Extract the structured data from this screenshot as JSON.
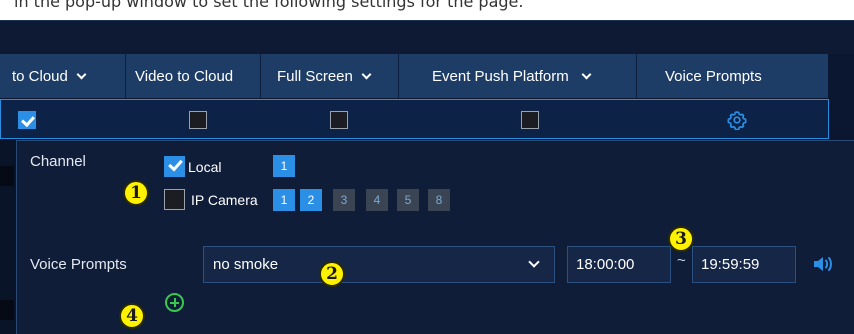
{
  "doc_caption": "in the pop-up window to set the following settings for the page.",
  "columns": {
    "upload_to_cloud": "to Cloud",
    "video_to_cloud": "Video to Cloud",
    "full_screen": "Full Screen",
    "event_push_platform": "Event Push Platform",
    "voice_prompts": "Voice Prompts"
  },
  "row_checks": {
    "upload_to_cloud": true,
    "video_to_cloud": false,
    "full_screen": false,
    "event_push_platform": false
  },
  "icons": {
    "settings": "gear-icon",
    "speaker": "speaker-icon",
    "add": "plus-circle-icon"
  },
  "panel": {
    "channel_label": "Channel",
    "local_label": "Local",
    "local_checked": true,
    "ip_camera_label": "IP Camera",
    "ip_camera_checked": false,
    "local_channels": [
      "1"
    ],
    "ip_channels": [
      {
        "label": "1",
        "state": "active"
      },
      {
        "label": "2",
        "state": "active"
      },
      {
        "label": "3",
        "state": "dim"
      },
      {
        "label": "4",
        "state": "dim"
      },
      {
        "label": "5",
        "state": "dim"
      },
      {
        "label": "8",
        "state": "dim"
      }
    ],
    "voice_prompts_label": "Voice Prompts",
    "voice_prompt_value": "no smoke",
    "start_time": "18:00:00",
    "time_separator": "~",
    "end_time": "19:59:59"
  },
  "callouts": [
    "1",
    "2",
    "3",
    "4"
  ],
  "colors": {
    "accent": "#2c8fe6",
    "header": "#1e3d66",
    "add": "#37c94a",
    "callout": "#fff200"
  }
}
